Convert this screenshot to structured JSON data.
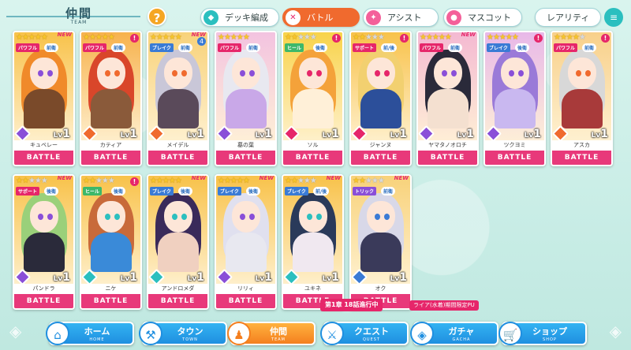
{
  "header": {
    "title": "仲間",
    "subtitle": "TEAM",
    "help_label": "?",
    "tabs": [
      {
        "label": "デッキ編成",
        "icon": "deck-icon",
        "glyph": "◆",
        "color": "#2bbfbf"
      },
      {
        "label": "バトル",
        "icon": "sword-icon",
        "glyph": "✕",
        "color": "#e6266a",
        "active": true
      },
      {
        "label": "アシスト",
        "icon": "assist-icon",
        "glyph": "✦",
        "color": "#f4609a"
      },
      {
        "label": "マスコット",
        "icon": "mascot-icon",
        "glyph": "●",
        "color": "#f4609a"
      },
      {
        "label": "レアリティ",
        "icon": "sort-icon",
        "glyph": "≡",
        "color": "#2bbfbf"
      }
    ]
  },
  "battle_label": "BATTLE",
  "level_prefix": "Lv",
  "characters": [
    {
      "name": "キュベレー",
      "stars": 5,
      "role": "パワフル",
      "role_color": "#e6266a",
      "pos": "前衛",
      "level": "1",
      "new": "NEW",
      "bang": false,
      "badge": "",
      "elem_color": "#8a4fd8",
      "bg": "#f8c24a",
      "hair": "#f08a2a",
      "outfit": "#7a4a2a"
    },
    {
      "name": "カティア",
      "stars": 5,
      "role": "パワフル",
      "role_color": "#e6266a",
      "pos": "前衛",
      "level": "1",
      "new": "",
      "bang": true,
      "badge": "",
      "elem_color": "#f06a2e",
      "bg": "#f7b24d",
      "hair": "#d9462a",
      "outfit": "#8a5a3a"
    },
    {
      "name": "メイデル",
      "stars": 5,
      "role": "ブレイク",
      "role_color": "#3a7bd5",
      "pos": "前衛",
      "level": "1",
      "new": "NEW",
      "bang": false,
      "badge": "4",
      "elem_color": "#f06a2e",
      "bg": "#f8d27a",
      "hair": "#c9c7d8",
      "outfit": "#5a4a5a"
    },
    {
      "name": "墓の葉",
      "stars": 5,
      "role": "パワフル",
      "role_color": "#e6266a",
      "pos": "前衛",
      "level": "1",
      "new": "",
      "bang": false,
      "badge": "",
      "elem_color": "#8a4fd8",
      "bg": "#f3c3e0",
      "hair": "#e8e8f0",
      "outfit": "#c9a8e8"
    },
    {
      "name": "ソル",
      "stars": 2,
      "role": "ヒール",
      "role_color": "#3db86a",
      "pos": "後衛",
      "level": "1",
      "new": "",
      "bang": true,
      "badge": "",
      "elem_color": "#e6266a",
      "bg": "#f8d34a",
      "hair": "#f4a23a",
      "outfit": "#fff0d8"
    },
    {
      "name": "ジャンヌ",
      "stars": 2,
      "role": "サポート",
      "role_color": "#e6266a",
      "pos": "前/後",
      "level": "1",
      "new": "",
      "bang": true,
      "badge": "",
      "elem_color": "#e6266a",
      "bg": "#f8c24a",
      "hair": "#f2d070",
      "outfit": "#2c4f9a"
    },
    {
      "name": "ヤマタノオロチ",
      "stars": 5,
      "role": "パワフル",
      "role_color": "#e6266a",
      "pos": "前衛",
      "level": "1",
      "new": "NEW",
      "bang": false,
      "badge": "",
      "elem_color": "#8a4fd8",
      "bg": "#f4b9d2",
      "hair": "#2a2a3a",
      "outfit": "#f4e0d0"
    },
    {
      "name": "ツクヨミ",
      "stars": 5,
      "role": "ブレイク",
      "role_color": "#3a7bd5",
      "pos": "後衛",
      "level": "1",
      "new": "",
      "bang": true,
      "badge": "",
      "elem_color": "#8a4fd8",
      "bg": "#e8b8e8",
      "hair": "#9a7ad8",
      "outfit": "#c9b8f0"
    },
    {
      "name": "アスカ",
      "stars": 4,
      "role": "パワフル",
      "role_color": "#e6266a",
      "pos": "前衛",
      "level": "1",
      "new": "",
      "bang": true,
      "badge": "",
      "elem_color": "#f06a2e",
      "bg": "#f8d08a",
      "hair": "#d8d8d8",
      "outfit": "#a83a3a"
    },
    {
      "name": "パンドラ",
      "stars": 2,
      "role": "サポート",
      "role_color": "#e6266a",
      "pos": "後衛",
      "level": "1",
      "new": "NEW",
      "bang": false,
      "badge": "",
      "elem_color": "#8a4fd8",
      "bg": "#f8c24a",
      "hair": "#9ad07a",
      "outfit": "#2a2a3a"
    },
    {
      "name": "ニケ",
      "stars": 2,
      "role": "ヒール",
      "role_color": "#3db86a",
      "pos": "後衛",
      "level": "1",
      "new": "",
      "bang": true,
      "badge": "",
      "elem_color": "#2bbfbf",
      "bg": "#f8c24a",
      "hair": "#c86a3a",
      "outfit": "#3a8ad8"
    },
    {
      "name": "アンドロメダ",
      "stars": 5,
      "role": "ブレイク",
      "role_color": "#3a7bd5",
      "pos": "後衛",
      "level": "1",
      "new": "NEW",
      "bang": false,
      "badge": "",
      "elem_color": "#2bbfbf",
      "bg": "#f8c24a",
      "hair": "#3a2a5a",
      "outfit": "#f0d0c0"
    },
    {
      "name": "リリィ",
      "stars": 5,
      "role": "ブレイク",
      "role_color": "#3a7bd5",
      "pos": "後衛",
      "level": "1",
      "new": "NEW",
      "bang": false,
      "badge": "",
      "elem_color": "#8a4fd8",
      "bg": "#f8c24a",
      "hair": "#e0e0ef",
      "outfit": "#e8e8f0"
    },
    {
      "name": "ユキネ",
      "stars": 2,
      "role": "ブレイク",
      "role_color": "#3a7bd5",
      "pos": "前/後",
      "level": "1",
      "new": "NEW",
      "bang": false,
      "badge": "",
      "elem_color": "#2bbfbf",
      "bg": "#f8c24a",
      "hair": "#2a3a5a",
      "outfit": "#f0e8f0"
    },
    {
      "name": "オク",
      "stars": 2,
      "role": "トリック",
      "role_color": "#8a4fd8",
      "pos": "前衛",
      "level": "1",
      "new": "NEW",
      "bang": false,
      "badge": "",
      "elem_color": "#3a7bd5",
      "bg": "#f8d27a",
      "hair": "#d8d8e8",
      "outfit": "#3a3a5a"
    }
  ],
  "nav": {
    "items": [
      {
        "label": "ホーム",
        "sub": "HOME",
        "icon": "home-icon",
        "glyph": "⌂"
      },
      {
        "label": "タウン",
        "sub": "TOWN",
        "icon": "town-icon",
        "glyph": "⚒"
      },
      {
        "label": "仲間",
        "sub": "TEAM",
        "icon": "team-icon",
        "glyph": "♟",
        "active": true
      },
      {
        "label": "クエスト",
        "sub": "QUEST",
        "icon": "quest-icon",
        "glyph": "⚔"
      },
      {
        "label": "ガチャ",
        "sub": "GACHA",
        "icon": "gacha-icon",
        "glyph": "◈"
      },
      {
        "label": "ショップ",
        "sub": "SHOP",
        "icon": "shop-icon",
        "glyph": "🛒"
      }
    ],
    "quest_tip": "第1章 18話進行中",
    "gacha_tip": "ライア(水着)期間限定PU"
  }
}
